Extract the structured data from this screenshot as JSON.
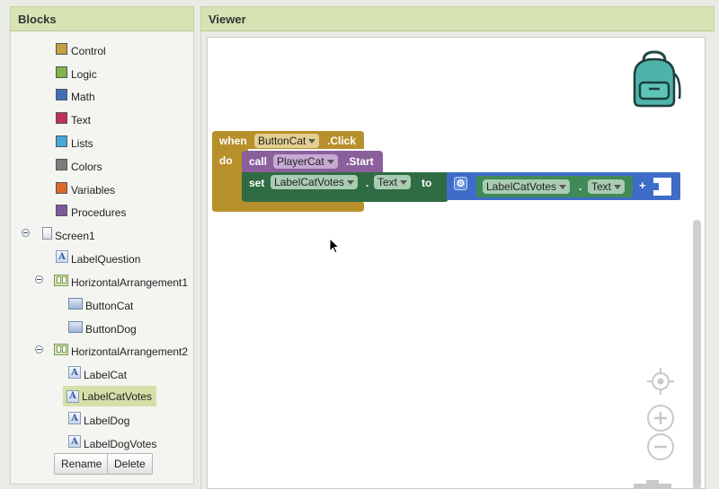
{
  "blocks_panel": {
    "title": "Blocks",
    "builtins": [
      {
        "label": "Control",
        "color": "#c4a040"
      },
      {
        "label": "Logic",
        "color": "#83b34b"
      },
      {
        "label": "Math",
        "color": "#3e6fb8"
      },
      {
        "label": "Text",
        "color": "#c42f5a"
      },
      {
        "label": "Lists",
        "color": "#46a7dc"
      },
      {
        "label": "Colors",
        "color": "#7d7d7d"
      },
      {
        "label": "Variables",
        "color": "#e0682b"
      },
      {
        "label": "Procedures",
        "color": "#7c5a9c"
      }
    ],
    "components": {
      "screen": "Screen1",
      "label_question": "LabelQuestion",
      "harr1": "HorizontalArrangement1",
      "button_cat": "ButtonCat",
      "button_dog": "ButtonDog",
      "harr2": "HorizontalArrangement2",
      "label_cat": "LabelCat",
      "label_cat_votes": "LabelCatVotes",
      "label_dog": "LabelDog",
      "label_dog_votes": "LabelDogVotes"
    },
    "rename_label": "Rename",
    "delete_label": "Delete"
  },
  "viewer": {
    "title": "Viewer",
    "event_block": {
      "when": "when",
      "component": "ButtonCat",
      "event": ".Click",
      "do": "do"
    },
    "call_block": {
      "call": "call",
      "component": "PlayerCat",
      "method": ".Start"
    },
    "set_block": {
      "set": "set",
      "component": "LabelCatVotes",
      "dot": ".",
      "property": "Text",
      "to": "to"
    },
    "getter_block": {
      "component": "LabelCatVotes",
      "dot": ".",
      "property": "Text"
    },
    "plus": "+",
    "colors": {
      "event": "#b8902b",
      "call": "#8a5f9c",
      "set": "#2f6b43",
      "math": "#3f6cc7",
      "getter": "#3f8a56"
    }
  }
}
